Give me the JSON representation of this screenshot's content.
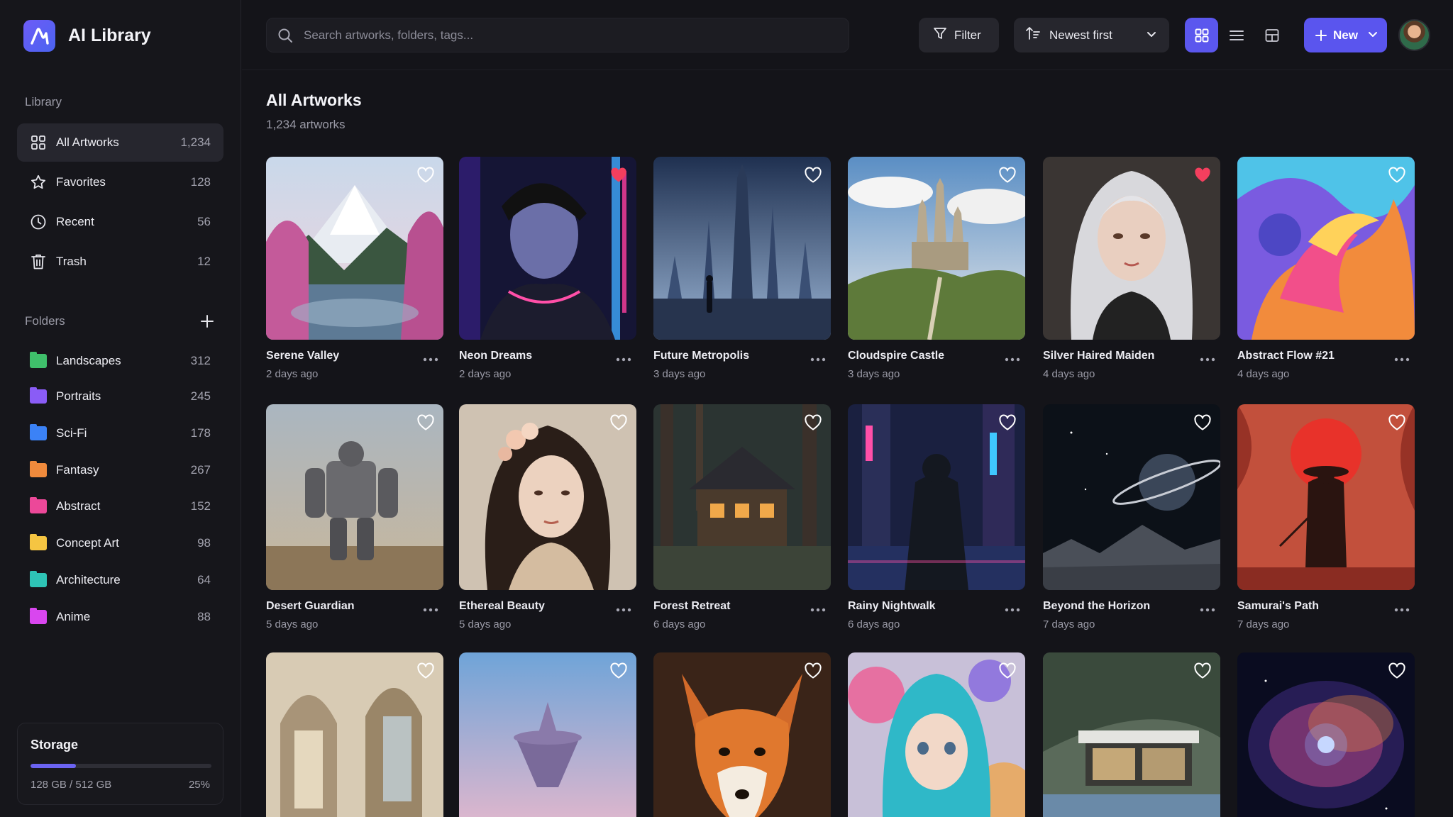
{
  "app": {
    "title": "AI Library"
  },
  "sidebar": {
    "library_label": "Library",
    "nav": [
      {
        "label": "All Artworks",
        "count": "1,234",
        "icon": "grid-icon",
        "active": true
      },
      {
        "label": "Favorites",
        "count": "128",
        "icon": "star-icon"
      },
      {
        "label": "Recent",
        "count": "56",
        "icon": "clock-icon"
      },
      {
        "label": "Trash",
        "count": "12",
        "icon": "trash-icon"
      }
    ],
    "folders_label": "Folders",
    "folders": [
      {
        "label": "Landscapes",
        "count": "312",
        "color": "#3fbf6b"
      },
      {
        "label": "Portraits",
        "count": "245",
        "color": "#8a5cf6"
      },
      {
        "label": "Sci-Fi",
        "count": "178",
        "color": "#3b82f6"
      },
      {
        "label": "Fantasy",
        "count": "267",
        "color": "#f08a3c"
      },
      {
        "label": "Abstract",
        "count": "152",
        "color": "#ec4899"
      },
      {
        "label": "Concept Art",
        "count": "98",
        "color": "#f5c542"
      },
      {
        "label": "Architecture",
        "count": "64",
        "color": "#2ec4b6"
      },
      {
        "label": "Anime",
        "count": "88",
        "color": "#d946ef"
      }
    ],
    "storage": {
      "title": "Storage",
      "used": "128 GB / 512 GB",
      "percent_label": "25%",
      "fraction": 0.25
    }
  },
  "toolbar": {
    "search_placeholder": "Search artworks, folders, tags...",
    "filter_label": "Filter",
    "sort_label": "Newest first",
    "new_label": "New"
  },
  "main": {
    "title": "All Artworks",
    "subtitle": "1,234 artworks",
    "artworks": [
      {
        "title": "Serene Valley",
        "date": "2 days ago",
        "favorite": false
      },
      {
        "title": "Neon Dreams",
        "date": "2 days ago",
        "favorite": true
      },
      {
        "title": "Future Metropolis",
        "date": "3 days ago",
        "favorite": false
      },
      {
        "title": "Cloudspire Castle",
        "date": "3 days ago",
        "favorite": false
      },
      {
        "title": "Silver Haired Maiden",
        "date": "4 days ago",
        "favorite": true
      },
      {
        "title": "Abstract Flow #21",
        "date": "4 days ago",
        "favorite": false
      },
      {
        "title": "Desert Guardian",
        "date": "5 days ago",
        "favorite": false
      },
      {
        "title": "Ethereal Beauty",
        "date": "5 days ago",
        "favorite": false
      },
      {
        "title": "Forest Retreat",
        "date": "6 days ago",
        "favorite": false
      },
      {
        "title": "Rainy Nightwalk",
        "date": "6 days ago",
        "favorite": false
      },
      {
        "title": "Beyond the Horizon",
        "date": "7 days ago",
        "favorite": false
      },
      {
        "title": "Samurai's Path",
        "date": "7 days ago",
        "favorite": false
      },
      {
        "favorite": false
      },
      {
        "favorite": false
      },
      {
        "favorite": false
      },
      {
        "favorite": false
      },
      {
        "favorite": false
      },
      {
        "favorite": false
      }
    ]
  },
  "colors": {
    "accent": "#5a55ee",
    "favorite": "#f43f5e",
    "background": "#141419"
  }
}
